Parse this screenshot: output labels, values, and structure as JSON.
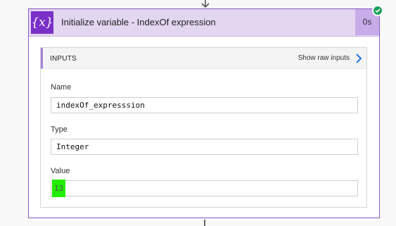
{
  "action": {
    "title": "Initialize variable - IndexOf expression",
    "duration": "0s",
    "status": "succeeded",
    "icon": "variable-icon",
    "icon_glyph": "{x}"
  },
  "inputs": {
    "section_label": "INPUTS",
    "raw_link": "Show raw inputs",
    "fields": {
      "name": {
        "label": "Name",
        "value": "indexOf_expresssion"
      },
      "type": {
        "label": "Type",
        "value": "Integer"
      },
      "value": {
        "label": "Value",
        "value": "13"
      }
    }
  },
  "colors": {
    "accent": "#7a2fc8",
    "header_bg": "#e3d6f1",
    "success": "#1aa35a",
    "highlight": "#22ee00"
  }
}
